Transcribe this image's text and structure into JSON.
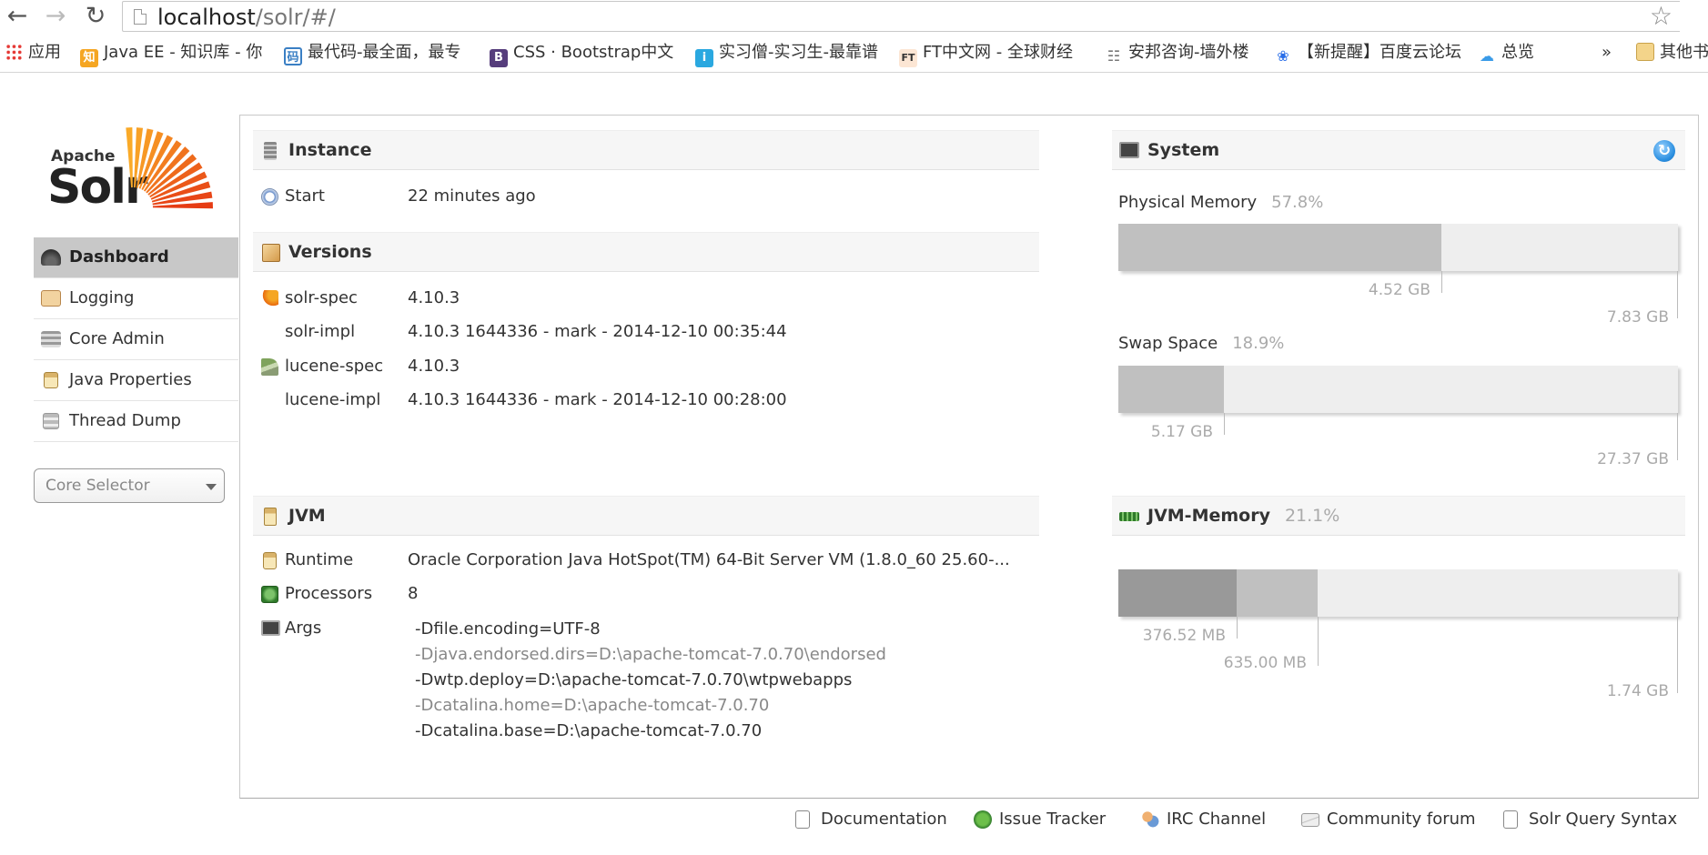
{
  "browser": {
    "url_host": "localhost",
    "url_path": "/solr/#/",
    "bookmarks": [
      {
        "label": "应用",
        "icon": "apps-grid-icon",
        "color": "#e53935"
      },
      {
        "label": "Java EE - 知识库 - 你",
        "icon": "zhi-logo-icon",
        "color": "#f5a623"
      },
      {
        "label": "最代码-最全面，最专",
        "icon": "zuidaima-logo-icon",
        "color": "#3a7fc4"
      },
      {
        "label": "CSS · Bootstrap中文",
        "icon": "bootstrap-logo-icon",
        "color": "#563d7c"
      },
      {
        "label": "实习僧-实习生-最靠谱",
        "icon": "shixiseng-logo-icon",
        "color": "#2aa8e0"
      },
      {
        "label": "FT中文网 - 全球财经",
        "icon": "ft-logo-icon",
        "color": "#fce6d4"
      },
      {
        "label": "安邦咨询-墙外楼",
        "icon": "network-icon",
        "color": "#777777"
      },
      {
        "label": "【新提醒】百度云论坛",
        "icon": "baidu-logo-icon",
        "color": "#2a6ee8"
      },
      {
        "label": "总览",
        "icon": "cloud-icon",
        "color": "#3a9be8"
      }
    ],
    "more": "»",
    "other_bookmarks": "其他书"
  },
  "logo": {
    "apache": "Apache",
    "solr": "Solr"
  },
  "menu": [
    {
      "label": "Dashboard",
      "icon": "dashboard-icon",
      "active": true
    },
    {
      "label": "Logging",
      "icon": "logging-icon"
    },
    {
      "label": "Core Admin",
      "icon": "core-admin-icon"
    },
    {
      "label": "Java Properties",
      "icon": "java-properties-icon"
    },
    {
      "label": "Thread Dump",
      "icon": "thread-dump-icon"
    }
  ],
  "core_selector": {
    "placeholder": "Core Selector"
  },
  "instance": {
    "title": "Instance",
    "start_label": "Start",
    "start_value": "22 minutes ago"
  },
  "versions": {
    "title": "Versions",
    "rows": [
      {
        "key": "solr-spec",
        "value": "4.10.3"
      },
      {
        "key": "solr-impl",
        "value": "4.10.3 1644336 - mark - 2014-12-10 00:35:44"
      },
      {
        "key": "lucene-spec",
        "value": "4.10.3"
      },
      {
        "key": "lucene-impl",
        "value": "4.10.3 1644336 - mark - 2014-12-10 00:28:00"
      }
    ]
  },
  "jvm": {
    "title": "JVM",
    "runtime_label": "Runtime",
    "runtime_value": "Oracle Corporation Java HotSpot(TM) 64-Bit Server VM (1.8.0_60 25.60-...",
    "processors_label": "Processors",
    "processors_value": "8",
    "args_label": "Args",
    "args": [
      "-Dfile.encoding=UTF-8",
      "-Djava.endorsed.dirs=D:\\apache-tomcat-7.0.70\\endorsed",
      "-Dwtp.deploy=D:\\apache-tomcat-7.0.70\\wtpwebapps",
      "-Dcatalina.home=D:\\apache-tomcat-7.0.70",
      "-Dcatalina.base=D:\\apache-tomcat-7.0.70"
    ]
  },
  "system": {
    "title": "System",
    "physical": {
      "label": "Physical Memory",
      "percent_text": "57.8%",
      "used_fraction": 0.578,
      "used_text": "4.52 GB",
      "total_text": "7.83 GB"
    },
    "swap": {
      "label": "Swap Space",
      "percent_text": "18.9%",
      "used_fraction": 0.189,
      "used_text": "5.17 GB",
      "total_text": "27.37 GB"
    }
  },
  "jvm_memory": {
    "title": "JVM-Memory",
    "percent_text": "21.1%",
    "used_fraction": 0.211,
    "committed_fraction": 0.356,
    "used_text": "376.52 MB",
    "committed_text": "635.00 MB",
    "max_text": "1.74 GB"
  },
  "footer": [
    {
      "label": "Documentation",
      "icon": "documentation-icon"
    },
    {
      "label": "Issue Tracker",
      "icon": "bug-icon"
    },
    {
      "label": "IRC Channel",
      "icon": "irc-icon"
    },
    {
      "label": "Community forum",
      "icon": "mail-icon"
    },
    {
      "label": "Solr Query Syntax",
      "icon": "query-syntax-icon"
    }
  ]
}
